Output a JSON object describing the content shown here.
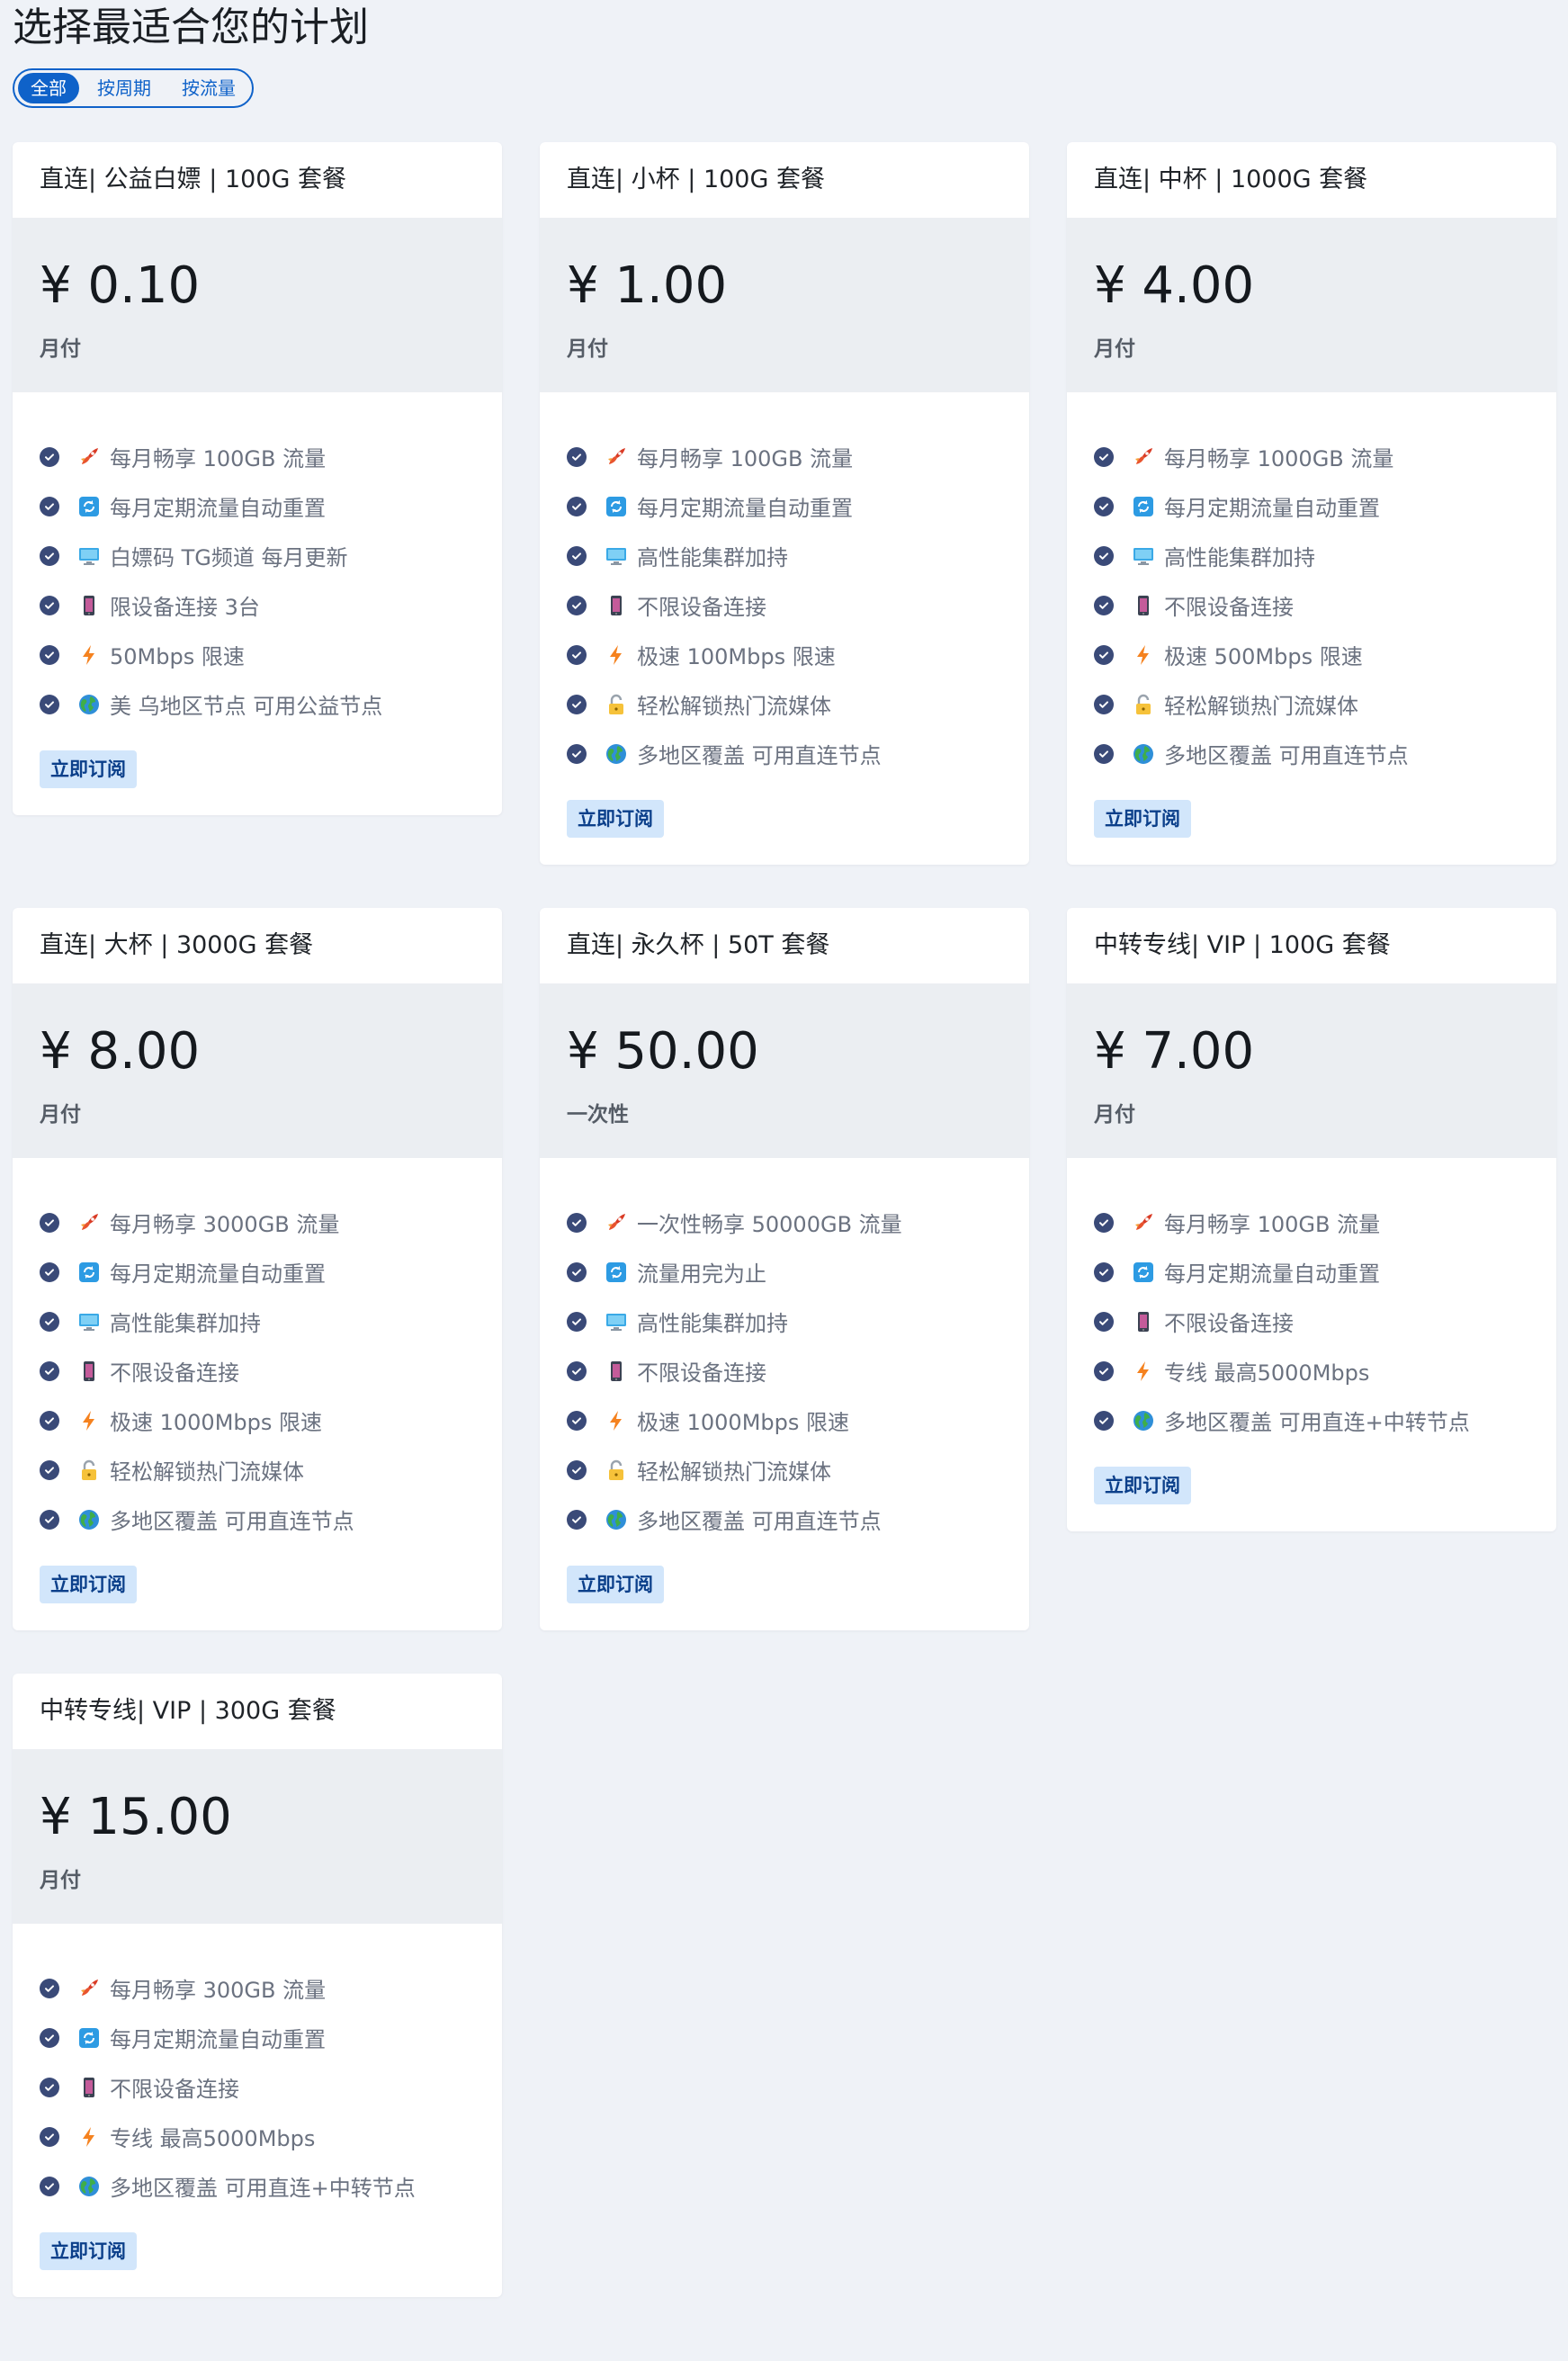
{
  "header": {
    "title": "选择最适合您的计划",
    "tabs": [
      {
        "label": "全部",
        "active": true
      },
      {
        "label": "按周期",
        "active": false
      },
      {
        "label": "按流量",
        "active": false
      }
    ]
  },
  "subscribe_label": "立即订阅",
  "plans": [
    {
      "title": "直连| 公益白嫖 | 100G 套餐",
      "price": "¥ 0.10",
      "period": "月付",
      "features": [
        {
          "icon": "rocket-icon",
          "text": "每月畅享 100GB 流量"
        },
        {
          "icon": "refresh-icon",
          "text": "每月定期流量自动重置"
        },
        {
          "icon": "monitor-icon",
          "text": "白嫖码 TG频道 每月更新"
        },
        {
          "icon": "phone-icon",
          "text": "限设备连接 3台"
        },
        {
          "icon": "lightning-icon",
          "text": "50Mbps 限速"
        },
        {
          "icon": "globe-icon",
          "text": "美 乌地区节点 可用公益节点"
        }
      ]
    },
    {
      "title": "直连| 小杯 | 100G 套餐",
      "price": "¥ 1.00",
      "period": "月付",
      "features": [
        {
          "icon": "rocket-icon",
          "text": "每月畅享 100GB 流量"
        },
        {
          "icon": "refresh-icon",
          "text": "每月定期流量自动重置"
        },
        {
          "icon": "monitor-icon",
          "text": "高性能集群加持"
        },
        {
          "icon": "phone-icon",
          "text": "不限设备连接"
        },
        {
          "icon": "lightning-icon",
          "text": "极速 100Mbps 限速"
        },
        {
          "icon": "unlock-icon",
          "text": "轻松解锁热门流媒体"
        },
        {
          "icon": "globe-icon",
          "text": "多地区覆盖 可用直连节点"
        }
      ]
    },
    {
      "title": "直连| 中杯 | 1000G 套餐",
      "price": "¥ 4.00",
      "period": "月付",
      "features": [
        {
          "icon": "rocket-icon",
          "text": "每月畅享 1000GB 流量"
        },
        {
          "icon": "refresh-icon",
          "text": "每月定期流量自动重置"
        },
        {
          "icon": "monitor-icon",
          "text": "高性能集群加持"
        },
        {
          "icon": "phone-icon",
          "text": "不限设备连接"
        },
        {
          "icon": "lightning-icon",
          "text": "极速 500Mbps 限速"
        },
        {
          "icon": "unlock-icon",
          "text": "轻松解锁热门流媒体"
        },
        {
          "icon": "globe-icon",
          "text": "多地区覆盖 可用直连节点"
        }
      ]
    },
    {
      "title": "直连| 大杯 | 3000G 套餐",
      "price": "¥ 8.00",
      "period": "月付",
      "features": [
        {
          "icon": "rocket-icon",
          "text": "每月畅享 3000GB 流量"
        },
        {
          "icon": "refresh-icon",
          "text": "每月定期流量自动重置"
        },
        {
          "icon": "monitor-icon",
          "text": "高性能集群加持"
        },
        {
          "icon": "phone-icon",
          "text": "不限设备连接"
        },
        {
          "icon": "lightning-icon",
          "text": "极速 1000Mbps 限速"
        },
        {
          "icon": "unlock-icon",
          "text": "轻松解锁热门流媒体"
        },
        {
          "icon": "globe-icon",
          "text": "多地区覆盖 可用直连节点"
        }
      ]
    },
    {
      "title": "直连| 永久杯 | 50T 套餐",
      "price": "¥ 50.00",
      "period": "一次性",
      "features": [
        {
          "icon": "rocket-icon",
          "text": "一次性畅享 50000GB 流量"
        },
        {
          "icon": "refresh-icon",
          "text": "流量用完为止"
        },
        {
          "icon": "monitor-icon",
          "text": "高性能集群加持"
        },
        {
          "icon": "phone-icon",
          "text": "不限设备连接"
        },
        {
          "icon": "lightning-icon",
          "text": "极速 1000Mbps 限速"
        },
        {
          "icon": "unlock-icon",
          "text": "轻松解锁热门流媒体"
        },
        {
          "icon": "globe-icon",
          "text": "多地区覆盖 可用直连节点"
        }
      ]
    },
    {
      "title": "中转专线| VIP | 100G 套餐",
      "price": "¥ 7.00",
      "period": "月付",
      "features": [
        {
          "icon": "rocket-icon",
          "text": "每月畅享 100GB 流量"
        },
        {
          "icon": "refresh-icon",
          "text": "每月定期流量自动重置"
        },
        {
          "icon": "phone-icon",
          "text": "不限设备连接"
        },
        {
          "icon": "lightning-icon",
          "text": "专线 最高5000Mbps"
        },
        {
          "icon": "globe-icon",
          "text": "多地区覆盖 可用直连+中转节点"
        }
      ]
    },
    {
      "title": "中转专线| VIP | 300G 套餐",
      "price": "¥ 15.00",
      "period": "月付",
      "features": [
        {
          "icon": "rocket-icon",
          "text": "每月畅享 300GB 流量"
        },
        {
          "icon": "refresh-icon",
          "text": "每月定期流量自动重置"
        },
        {
          "icon": "phone-icon",
          "text": "不限设备连接"
        },
        {
          "icon": "lightning-icon",
          "text": "专线 最高5000Mbps"
        },
        {
          "icon": "globe-icon",
          "text": "多地区覆盖 可用直连+中转节点"
        }
      ]
    }
  ]
}
